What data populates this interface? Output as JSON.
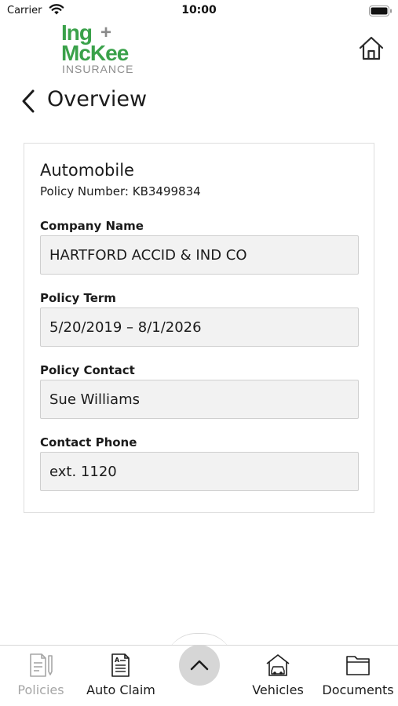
{
  "status_bar": {
    "carrier": "Carrier",
    "time": "10:00"
  },
  "header": {
    "logo_line1": "Ing",
    "logo_plus": "+",
    "logo_line2": "McKee",
    "logo_line3": "INSURANCE",
    "home_icon": "home-icon"
  },
  "page": {
    "title": "Overview",
    "back_icon": "chevron-left-icon"
  },
  "policy": {
    "type": "Automobile",
    "number_text": "Policy Number: KB3499834",
    "fields": [
      {
        "label": "Company Name",
        "value": "HARTFORD ACCID & IND CO"
      },
      {
        "label": "Policy Term",
        "value": "5/20/2019 – 8/1/2026"
      },
      {
        "label": "Policy Contact",
        "value": "Sue Williams"
      },
      {
        "label": "Contact Phone",
        "value": "ext. 1120"
      }
    ]
  },
  "tab_bar": {
    "tabs": [
      {
        "label": "Policies",
        "icon": "policies-icon",
        "active": false
      },
      {
        "label": "Auto Claim",
        "icon": "auto-claim-icon",
        "active": true
      },
      {
        "label": "Vehicles",
        "icon": "vehicles-icon",
        "active": true
      },
      {
        "label": "Documents",
        "icon": "documents-icon",
        "active": true
      }
    ],
    "center_icon": "chevron-up-icon"
  },
  "colors": {
    "brand_green": "#3aa14a",
    "brand_gray": "#8d8d8d",
    "field_bg": "#f2f2f2",
    "inactive_tab": "#a6a6a6",
    "active_tab": "#1b1b1b"
  }
}
